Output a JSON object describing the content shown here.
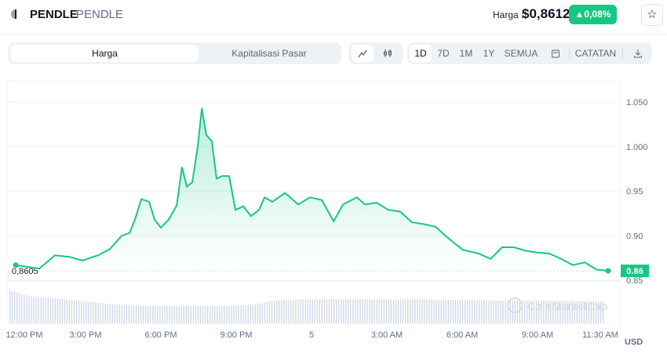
{
  "header": {
    "symbol": "PENDLE",
    "name": "PENDLE",
    "price_label": "Harga :",
    "price": "$0,8612",
    "change": "▲0,08%",
    "star_icon": "☆"
  },
  "toolbar": {
    "tabs": [
      "Harga",
      "Kapitalisasi Pasar"
    ],
    "ranges": [
      "1D",
      "7D",
      "1M",
      "1Y",
      "SEMUA"
    ],
    "notes": "CATATAN"
  },
  "colors": {
    "up": "#16c784",
    "axis": "#616e85",
    "grid": "#eff2f5",
    "volume": "#cfd6e4"
  },
  "chart_data": {
    "type": "line",
    "ylabel": "USD",
    "ylim": [
      0.83,
      1.07
    ],
    "yticks": [
      "1.050",
      "1.000",
      "0.95",
      "0.90",
      "0.85"
    ],
    "ytick_values": [
      1.05,
      1.0,
      0.95,
      0.9,
      0.85
    ],
    "xticks": [
      "12:00 PM",
      "3:00 PM",
      "6:00 PM",
      "9:00 PM",
      "5",
      "3:00 AM",
      "6:00 AM",
      "9:00 AM",
      "11:30 AM"
    ],
    "xtick_hours": [
      0,
      3,
      6,
      9,
      12,
      15,
      18,
      21,
      23.5
    ],
    "open_price": 0.8605,
    "open_label": "0,8605",
    "current_label": "0.86",
    "watermark": "CoinMarketCap",
    "series": [
      {
        "name": "PENDLE",
        "points": [
          [
            0.22,
            0.867
          ],
          [
            1.16,
            0.863
          ],
          [
            1.78,
            0.878
          ],
          [
            2.41,
            0.876
          ],
          [
            2.88,
            0.872
          ],
          [
            3.5,
            0.878
          ],
          [
            3.97,
            0.885
          ],
          [
            4.44,
            0.9
          ],
          [
            4.75,
            0.903
          ],
          [
            4.97,
            0.918
          ],
          [
            5.22,
            0.941
          ],
          [
            5.53,
            0.938
          ],
          [
            5.75,
            0.918
          ],
          [
            6.0,
            0.909
          ],
          [
            6.31,
            0.918
          ],
          [
            6.63,
            0.934
          ],
          [
            6.84,
            0.977
          ],
          [
            7.03,
            0.955
          ],
          [
            7.25,
            0.96
          ],
          [
            7.47,
            1.0
          ],
          [
            7.63,
            1.043
          ],
          [
            7.81,
            1.013
          ],
          [
            8.03,
            1.006
          ],
          [
            8.22,
            0.964
          ],
          [
            8.44,
            0.967
          ],
          [
            8.72,
            0.967
          ],
          [
            8.97,
            0.929
          ],
          [
            9.28,
            0.933
          ],
          [
            9.59,
            0.922
          ],
          [
            9.91,
            0.929
          ],
          [
            10.13,
            0.943
          ],
          [
            10.44,
            0.938
          ],
          [
            10.94,
            0.948
          ],
          [
            11.47,
            0.935
          ],
          [
            11.94,
            0.943
          ],
          [
            12.41,
            0.94
          ],
          [
            12.88,
            0.916
          ],
          [
            13.25,
            0.935
          ],
          [
            13.81,
            0.943
          ],
          [
            14.13,
            0.935
          ],
          [
            14.59,
            0.937
          ],
          [
            15.06,
            0.929
          ],
          [
            15.53,
            0.927
          ],
          [
            16.0,
            0.915
          ],
          [
            16.47,
            0.913
          ],
          [
            16.94,
            0.91
          ],
          [
            17.41,
            0.898
          ],
          [
            18.03,
            0.884
          ],
          [
            18.66,
            0.88
          ],
          [
            19.13,
            0.874
          ],
          [
            19.59,
            0.887
          ],
          [
            20.06,
            0.887
          ],
          [
            20.53,
            0.883
          ],
          [
            21.0,
            0.881
          ],
          [
            21.47,
            0.88
          ],
          [
            21.94,
            0.874
          ],
          [
            22.41,
            0.867
          ],
          [
            22.88,
            0.87
          ],
          [
            23.34,
            0.862
          ],
          [
            23.81,
            0.8605
          ]
        ]
      }
    ],
    "volume_relative": [
      0.95,
      0.8,
      0.75,
      0.7,
      0.65,
      0.6,
      0.55,
      0.52,
      0.5,
      0.5,
      0.5,
      0.5,
      0.5,
      0.52,
      0.55,
      0.65,
      0.68,
      0.7,
      0.7,
      0.7,
      0.7,
      0.7,
      0.7,
      0.7,
      0.7,
      0.68,
      0.68,
      0.68,
      0.66,
      0.66,
      0.66,
      0.65,
      0.65,
      0.64,
      0.64
    ]
  }
}
